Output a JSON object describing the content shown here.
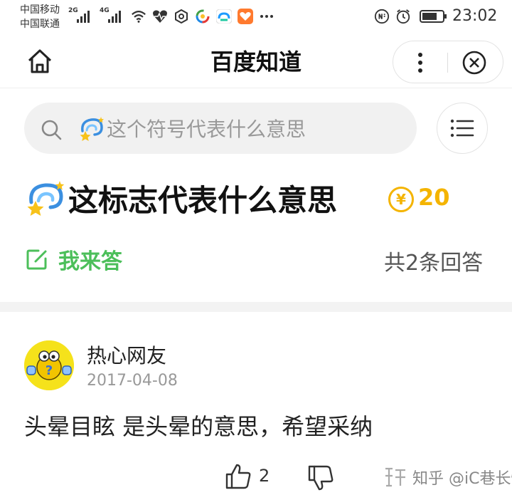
{
  "status_bar": {
    "carrier1": "中国移动",
    "carrier2": "中国联通",
    "net1": "2G",
    "net2": "4G",
    "time": "23:02",
    "icons": [
      "signal-icon",
      "wifi-icon",
      "heart-rate-icon",
      "hexagon-icon",
      "colorful-app-icon",
      "cloud-app-icon",
      "orange-app-icon",
      "more-dots-icon",
      "nfc-icon",
      "alarm-icon",
      "battery-icon"
    ]
  },
  "header": {
    "title": "百度知道",
    "icons": [
      "home-icon",
      "more-vertical-icon",
      "close-icon"
    ]
  },
  "search": {
    "placeholder": "这个符号代表什么意思",
    "icons": [
      "search-icon",
      "dizzy-emoji-icon",
      "list-menu-icon"
    ]
  },
  "question": {
    "title": "这标志代表什么意思",
    "coin_symbol": "¥",
    "bounty": "20",
    "answer_label": "我来答",
    "answer_count": "共2条回答",
    "icons": [
      "dizzy-emoji-icon",
      "coin-icon",
      "edit-icon"
    ]
  },
  "answer": {
    "author": "热心网友",
    "date": "2017-04-08",
    "text": "头晕目眩 是头晕的意思，希望采纳",
    "likes": "2",
    "icons": [
      "avatar-emoji",
      "thumbs-up-icon",
      "thumbs-down-icon"
    ]
  },
  "watermark": {
    "text": "知乎 @iC巷长情"
  },
  "colors": {
    "green": "#4cbf5a",
    "gold": "#f4b400",
    "search_bg": "#f1f1f1",
    "separator": "#f3f3f3"
  }
}
